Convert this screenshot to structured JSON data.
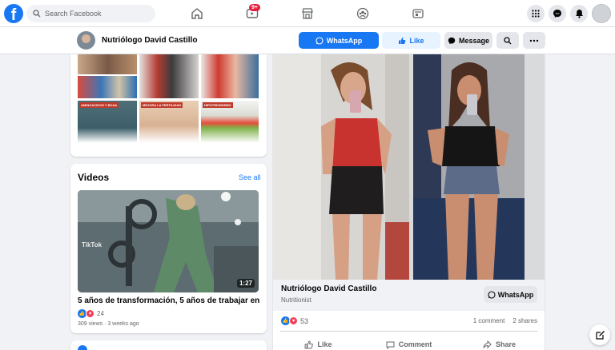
{
  "nav": {
    "logo_letter": "f",
    "search_placeholder": "Search Facebook",
    "video_badge": "9+"
  },
  "page_header": {
    "name": "Nutriólogo David Castillo",
    "whatsapp_label": "WhatsApp",
    "like_label": "Like",
    "message_label": "Message"
  },
  "photos": {
    "tiles": [
      {
        "label": ""
      },
      {
        "label": ""
      },
      {
        "label": ""
      },
      {
        "label": ""
      },
      {
        "label": ""
      },
      {
        "label": ""
      },
      {
        "label": ""
      },
      {
        "label": ""
      },
      {
        "label": "AMINOACIDOS Y BCAA"
      },
      {
        "label": "MEJORA LA FERTILIDAD"
      },
      {
        "label": "HIPOTIROIDISMO"
      }
    ]
  },
  "videos": {
    "title": "Videos",
    "see_all": "See all",
    "duration": "1:27",
    "watermark": "TikTok",
    "video_title": "5 años de transformación, 5 años de trabajar en ...",
    "reaction_count": "24",
    "meta": "309 views · 3 weeks ago"
  },
  "post": {
    "preview_name": "Nutriólogo David Castillo",
    "preview_sub": "Nutritionist",
    "preview_button": "WhatsApp",
    "reaction_count": "53",
    "comments": "1 comment",
    "shares": "2 shares",
    "actions": [
      "Like",
      "Comment",
      "Share"
    ]
  },
  "colors": {
    "brand": "#1877f2",
    "background": "#f0f2f5",
    "badge": "#e41e3f"
  }
}
